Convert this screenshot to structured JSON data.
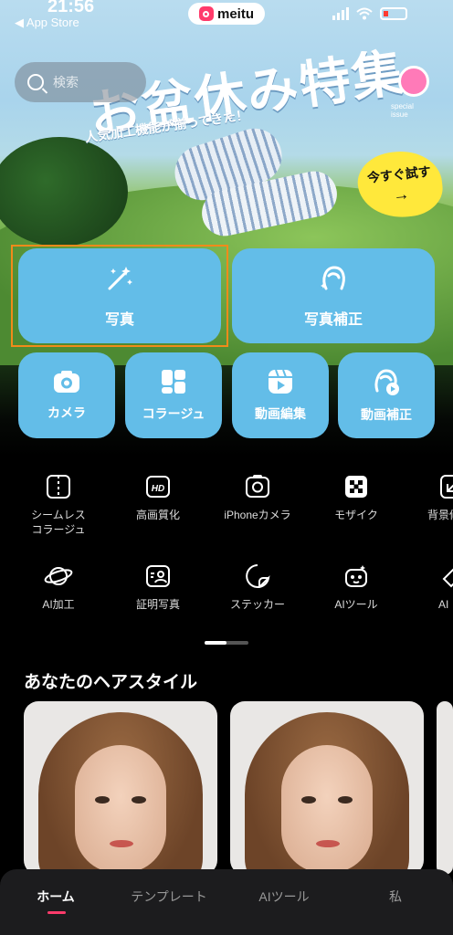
{
  "status_bar": {
    "time": "21:56",
    "back_label": "◀ App Store"
  },
  "brand": {
    "name": "meitu"
  },
  "search": {
    "placeholder": "検索"
  },
  "banner": {
    "title": "お盆休み特集",
    "subtitle": "人気加工機能が揃ってきた！",
    "badge": "special issue",
    "cta": "今すぐ試す",
    "cta_arrow": "→"
  },
  "main_actions": [
    {
      "label": "写真",
      "icon": "magic-wand-icon",
      "selected": true
    },
    {
      "label": "写真補正",
      "icon": "portrait-retouch-icon"
    }
  ],
  "quick_actions": [
    {
      "label": "カメラ",
      "icon": "camera-icon"
    },
    {
      "label": "コラージュ",
      "icon": "collage-icon"
    },
    {
      "label": "動画編集",
      "icon": "video-edit-icon"
    },
    {
      "label": "動画補正",
      "icon": "video-retouch-icon"
    }
  ],
  "tools_row1": [
    {
      "label": "シームレス\nコラージュ",
      "icon": "seamless-collage-icon"
    },
    {
      "label": "高画質化",
      "icon": "hd-icon"
    },
    {
      "label": "iPhoneカメラ",
      "icon": "iphone-camera-icon"
    },
    {
      "label": "モザイク",
      "icon": "mosaic-icon"
    },
    {
      "label": "背景修",
      "icon": "background-icon"
    }
  ],
  "tools_row2": [
    {
      "label": "AI加工",
      "icon": "planet-icon"
    },
    {
      "label": "証明写真",
      "icon": "id-photo-icon"
    },
    {
      "label": "ステッカー",
      "icon": "sticker-icon"
    },
    {
      "label": "AIツール",
      "icon": "robot-icon"
    },
    {
      "label": "AI",
      "icon": "eraser-icon"
    }
  ],
  "section": {
    "title": "あなたのヘアスタイル"
  },
  "tabbar": [
    {
      "label": "ホーム",
      "active": true
    },
    {
      "label": "テンプレート"
    },
    {
      "label": "AIツール"
    },
    {
      "label": "私"
    }
  ],
  "colors": {
    "accent": "#63bde8",
    "brand_pink": "#ff3b6b",
    "selection": "#f28a1a"
  }
}
